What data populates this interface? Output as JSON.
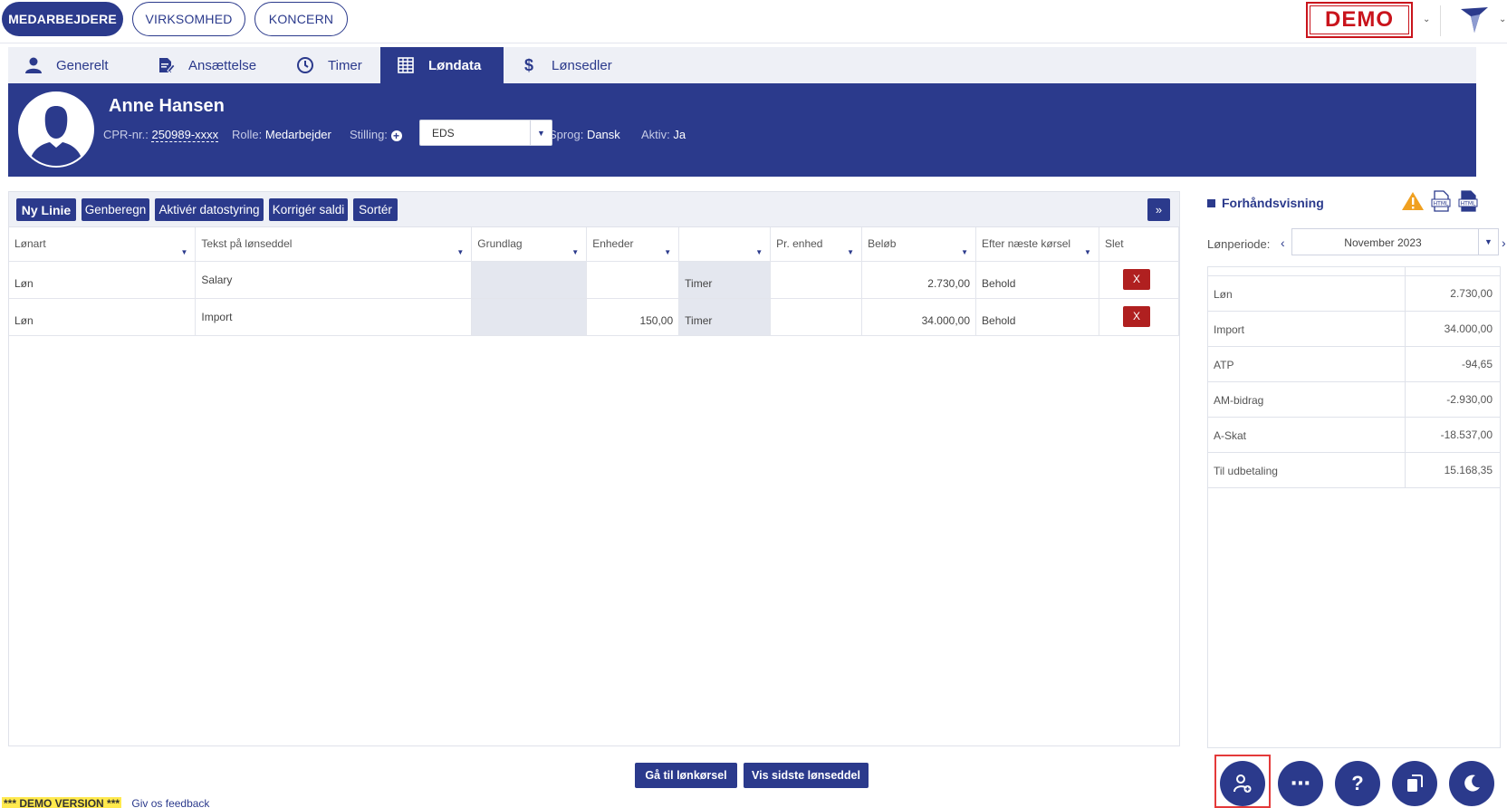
{
  "top_nav": {
    "tabs": [
      "MEDARBEJDERE",
      "VIRKSOMHED",
      "KONCERN"
    ],
    "demo_badge": "DEMO"
  },
  "sub_tabs": [
    "Generelt",
    "Ansættelse",
    "Timer",
    "Løndata",
    "Lønsedler"
  ],
  "employee": {
    "name": "Anne Hansen",
    "cpr_label": "CPR-nr.:",
    "cpr_value": "250989-xxxx",
    "role_label": "Rolle:",
    "role_value": "Medarbejder",
    "position_label": "Stilling:",
    "position_value": "EDS",
    "language_label": "Sprog:",
    "language_value": "Dansk",
    "active_label": "Aktiv:",
    "active_value": "Ja"
  },
  "toolbar": {
    "new_line": "Ny Linie",
    "recalc": "Genberegn",
    "activate_date": "Aktivér datostyring",
    "correct_balance": "Korrigér saldi",
    "sort": "Sortér",
    "expand": "»"
  },
  "grid": {
    "columns": [
      "Lønart",
      "Tekst på lønseddel",
      "Grundlag",
      "Enheder",
      "",
      "Pr. enhed",
      "Beløb",
      "Efter næste kørsel",
      "Slet"
    ],
    "rows": [
      {
        "lonart": "Løn",
        "tekst": "Salary",
        "grundlag": "",
        "enheder": "",
        "unit_type": "Timer",
        "pr_enhed": "",
        "belob": "2.730,00",
        "efter": "Behold",
        "slet": "X"
      },
      {
        "lonart": "Løn",
        "tekst": "Import",
        "grundlag": "",
        "enheder": "150,00",
        "unit_type": "Timer",
        "pr_enhed": "",
        "belob": "34.000,00",
        "efter": "Behold",
        "slet": "X"
      }
    ]
  },
  "preview": {
    "title": "Forhåndsvisning",
    "period_label": "Lønperiode:",
    "period_value": "November 2023",
    "rows": [
      {
        "label": "Løn",
        "amount": "2.730,00"
      },
      {
        "label": "Import",
        "amount": "34.000,00"
      },
      {
        "label": "ATP",
        "amount": "-94,65"
      },
      {
        "label": "AM-bidrag",
        "amount": "-2.930,00"
      },
      {
        "label": "A-Skat",
        "amount": "-18.537,00"
      },
      {
        "label": "Til udbetaling",
        "amount": "15.168,35"
      }
    ]
  },
  "bottom": {
    "go_payroll": "Gå til lønkørsel",
    "show_last_payslip": "Vis sidste lønseddel",
    "demo_version": "*** DEMO VERSION ***",
    "feedback": "Giv os feedback"
  },
  "colors": {
    "primary": "#2b3a8c",
    "danger": "#b02020",
    "demo_red": "#c9141c"
  }
}
